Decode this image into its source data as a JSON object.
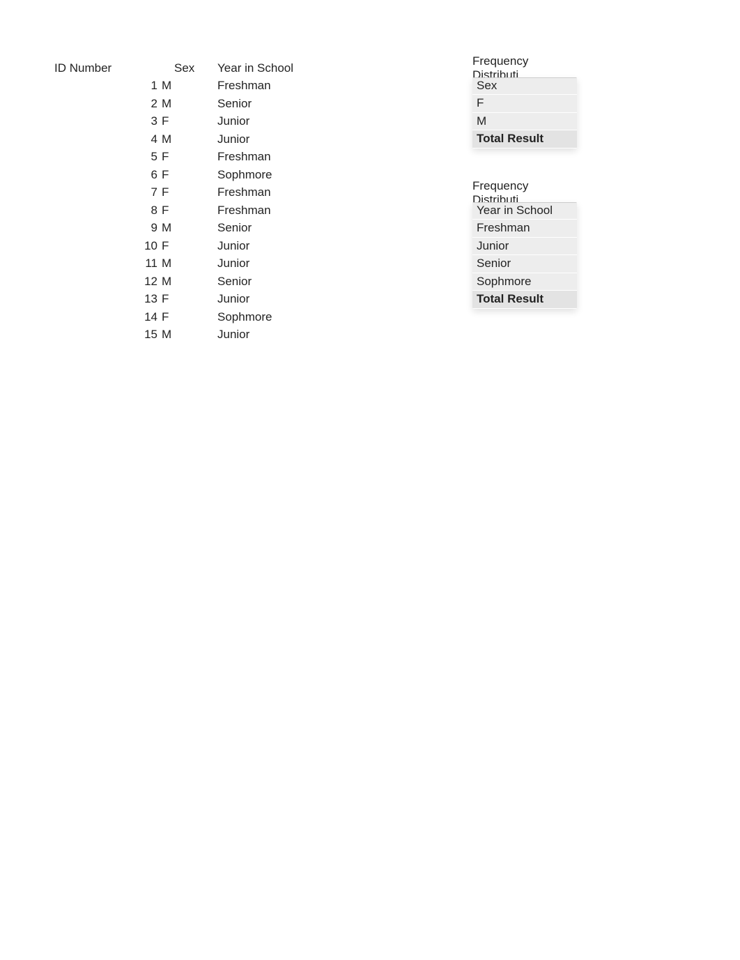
{
  "mainTable": {
    "headers": {
      "id": "ID Number",
      "sex": "Sex",
      "year": "Year in School"
    },
    "rows": [
      {
        "id": "1",
        "sex": "M",
        "year": "Freshman"
      },
      {
        "id": "2",
        "sex": "M",
        "year": "Senior"
      },
      {
        "id": "3",
        "sex": "F",
        "year": "Junior"
      },
      {
        "id": "4",
        "sex": "M",
        "year": "Junior"
      },
      {
        "id": "5",
        "sex": "F",
        "year": "Freshman"
      },
      {
        "id": "6",
        "sex": "F",
        "year": "Sophmore"
      },
      {
        "id": "7",
        "sex": "F",
        "year": "Freshman"
      },
      {
        "id": "8",
        "sex": "F",
        "year": "Freshman"
      },
      {
        "id": "9",
        "sex": "M",
        "year": "Senior"
      },
      {
        "id": "10",
        "sex": "F",
        "year": "Junior"
      },
      {
        "id": "11",
        "sex": "M",
        "year": "Junior"
      },
      {
        "id": "12",
        "sex": "M",
        "year": "Senior"
      },
      {
        "id": "13",
        "sex": "F",
        "year": "Junior"
      },
      {
        "id": "14",
        "sex": "F",
        "year": "Sophmore"
      },
      {
        "id": "15",
        "sex": "M",
        "year": "Junior"
      }
    ]
  },
  "pivot1": {
    "title": "Frequency Distributi",
    "header": "Sex",
    "rows": [
      "F",
      "M"
    ],
    "total": "Total Result"
  },
  "pivot2": {
    "title": "Frequency Distributi",
    "header": "Year in School",
    "rows": [
      "Freshman",
      "Junior",
      "Senior",
      "Sophmore"
    ],
    "total": "Total Result"
  }
}
